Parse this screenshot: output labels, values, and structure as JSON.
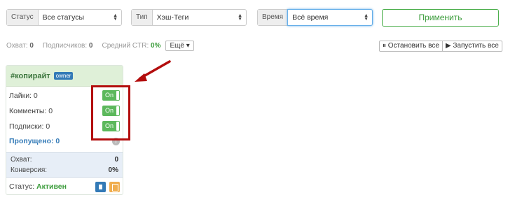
{
  "filters": {
    "status": {
      "label": "Статус",
      "value": "Все статусы"
    },
    "type": {
      "label": "Тип",
      "value": "Хэш-Теги"
    },
    "time": {
      "label": "Время",
      "value": "Всё время"
    },
    "apply_label": "Применить"
  },
  "stats": {
    "reach_label": "Охват:",
    "reach_value": "0",
    "subs_label": "Подписчиков:",
    "subs_value": "0",
    "ctr_label": "Средний CTR:",
    "ctr_value": "0%",
    "more_label": "Ещё ▾"
  },
  "controls": {
    "stop_all": "⏸ Остановить все",
    "start_all": "▶ Запустить все"
  },
  "card": {
    "title": "#копирайт",
    "badge": "owner",
    "rows": [
      {
        "label": "Лайки: 0",
        "toggle": "On"
      },
      {
        "label": "Комменты: 0",
        "toggle": "On"
      },
      {
        "label": "Подписки: 0",
        "toggle": "On"
      }
    ],
    "skipped": "Пропущено: 0",
    "info_icon": "i",
    "reach_label": "Охват:",
    "reach_value": "0",
    "conversion_label": "Конверсия:",
    "conversion_value": "0%",
    "status_label": "Статус:",
    "status_value": "Активен"
  },
  "colors": {
    "success": "#5cb85c",
    "primary": "#337ab7",
    "warning": "#f0ad4e",
    "annotation": "#b30d0d"
  }
}
